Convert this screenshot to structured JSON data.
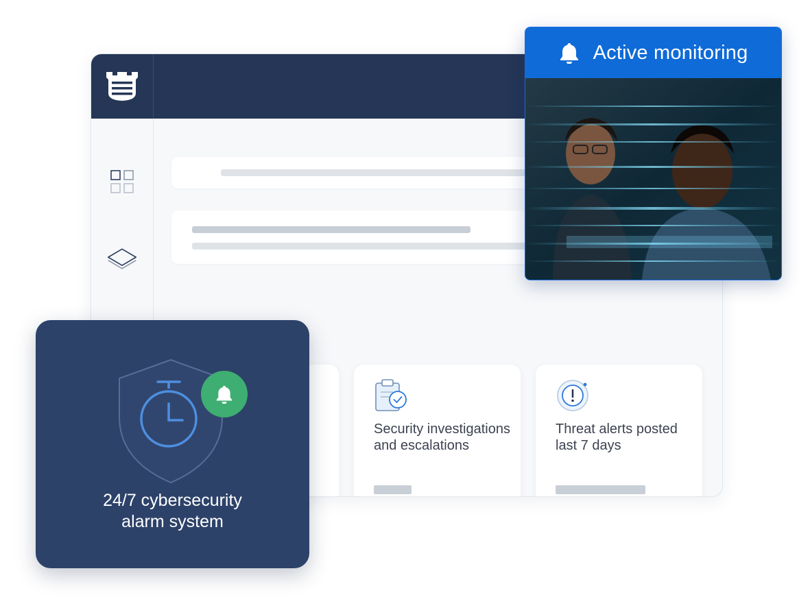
{
  "app_window": {
    "logo_icon": "fortress-logo-icon",
    "sidebar": {
      "items": [
        {
          "icon": "dashboard-grid-icon"
        },
        {
          "icon": "layers-icon"
        }
      ]
    },
    "cards": [
      {
        "label": "",
        "icon": ""
      },
      {
        "label": "Security investigations and escalations",
        "icon": "clipboard-check-icon"
      },
      {
        "label": "Threat alerts posted last 7 days",
        "icon": "alert-circle-icon"
      }
    ]
  },
  "monitoring": {
    "title": "Active monitoring",
    "icon": "bell-icon",
    "photo": "two analysts viewing screens with code reflections"
  },
  "alarm_card": {
    "title": "24/7 cybersecurity alarm system",
    "icons": [
      "shield-icon",
      "stopwatch-icon",
      "bell-badge-icon"
    ]
  },
  "colors": {
    "navy": "#253656",
    "card_navy": "#2d4269",
    "accent_blue": "#0f6bd7",
    "success_green": "#3fae72",
    "icon_blue": "#4d8fe0"
  }
}
